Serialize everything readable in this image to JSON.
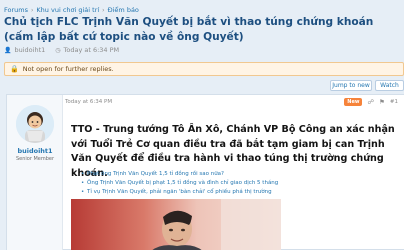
{
  "breadcrumb": {
    "items": [
      "Forums",
      "Khu vui chơi giải trí",
      "Điểm báo"
    ],
    "separator": "›"
  },
  "thread": {
    "title": "Chủ tịch FLC Trịnh Văn Quyết bị bắt vì thao túng chứng khoán (cấm lập bất cứ topic nào về ông Quyết)",
    "author": "buidoiht1",
    "date": "Today at 6:34 PM"
  },
  "notice": {
    "text": "Not open for further replies."
  },
  "buttons": {
    "jump_label": "Jump to new",
    "watch_label": "Watch"
  },
  "post": {
    "username": "buidoiht1",
    "user_title": "Senior Member",
    "date": "Today at 6:34 PM",
    "new_badge": "New",
    "post_number": "#1",
    "lead": "TTO - Trung tướng Tô Ân Xô, Chánh VP Bộ Công an xác nhận với Tuổi Trẻ Cơ quan điều tra đã bắt tạm giam bị can Trịnh Văn Quyết để điều tra hành vi thao túng thị trường chứng khoán.",
    "links": [
      "Phạt ông Trịnh Văn Quyết 1,5 tỉ đồng rồi sao nữa?",
      "Ông Trịnh Văn Quyết bị phạt 1,5 tỉ đồng và đình chỉ giao dịch 5 tháng",
      "Tỉ vụ Trịnh Văn Quyết, phải ngăn 'bàn chải' cổ phiếu phá thị trường"
    ]
  },
  "colors": {
    "link": "#2577b1",
    "title": "#1d4f80",
    "badge_new": "#f6833a",
    "notice_bg": "#fff4e5",
    "page_bg": "#e6eef6"
  },
  "icons": {
    "author": "user-icon",
    "date": "clock-icon",
    "notice": "lock-icon",
    "share": "share-icon",
    "bookmark": "bookmark-icon"
  }
}
